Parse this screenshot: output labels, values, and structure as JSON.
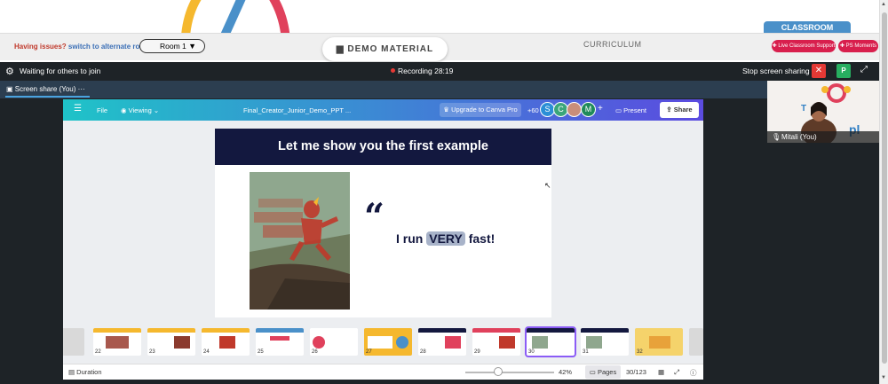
{
  "header": {
    "classroom_tab": "CLASSROOM",
    "issues_text": "Having issues?",
    "alternate_room_link": "switch to alternate room",
    "room_select": "Room 1",
    "demo_material_button": "DEMO MATERIAL",
    "curriculum_tab": "CURRICULUM",
    "live_support_button": "Live Classroom Support",
    "ps_moments_button": "PS Moments"
  },
  "meeting_bar": {
    "waiting_text": "Waiting for others to join",
    "recording_label": "Recording 28:19",
    "stop_share": "Stop screen sharing",
    "p_badge": "P",
    "screen_share_tab": "Screen share (You)",
    "tab_menu": "···"
  },
  "webcam": {
    "name": "Mitali (You)"
  },
  "canva": {
    "file_menu": "File",
    "viewing_menu": "Viewing",
    "doc_title": "Final_Creator_Junior_Demo_PPT ...",
    "upgrade_button": "Upgrade to Canva Pro",
    "more_count": "+60",
    "avatars": [
      "S",
      "C",
      "M"
    ],
    "present_button": "Present",
    "share_button": "Share",
    "slide_title": "Let me show you the first example",
    "quote_mark": "“",
    "quote_prefix": "I run",
    "quote_highlight": "VERY",
    "quote_suffix": "fast!",
    "thumb_numbers": [
      "22",
      "23",
      "24",
      "25",
      "26",
      "27",
      "28",
      "29",
      "30",
      "31",
      "32"
    ],
    "duration_label": "Duration",
    "zoom": "42%",
    "pages_button": "Pages",
    "page_count": "30/123"
  },
  "colors": {
    "accent_red": "#d81f4d",
    "slide_navy": "#13183f",
    "canva_teal": "#1fc3c8",
    "canva_purple": "#5b4be0"
  }
}
